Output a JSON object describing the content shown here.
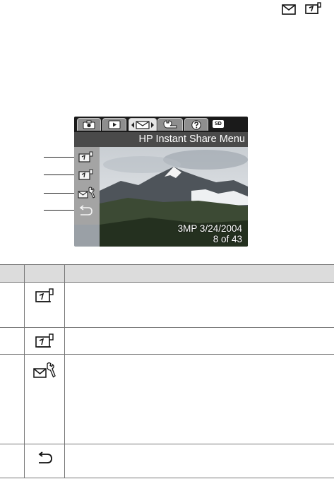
{
  "header": {
    "icons": [
      "email-envelope-icon",
      "print-icon"
    ]
  },
  "camera_screen": {
    "tabs": [
      {
        "icon": "camera-icon",
        "selected": false
      },
      {
        "icon": "playback-icon",
        "selected": false
      },
      {
        "icon": "share-email-icon",
        "selected": true
      },
      {
        "icon": "wrench-icon",
        "selected": false
      },
      {
        "icon": "help-icon",
        "selected": false
      }
    ],
    "sd_badge": "SD",
    "menu_title": "HP Instant Share Menu",
    "menu_items": [
      {
        "icon": "print-icon"
      },
      {
        "icon": "print-icon"
      },
      {
        "icon": "email-setup-wrench-icon"
      },
      {
        "icon": "return-arrow-icon"
      }
    ],
    "photo_info": {
      "resolution_date": "3MP  3/24/2004",
      "position": "8 of 43"
    }
  },
  "table": {
    "header_row": [
      "",
      "",
      ""
    ],
    "rows": [
      {
        "icon": "print-icon"
      },
      {
        "icon": "print-icon"
      },
      {
        "icon": "email-setup-wrench-icon"
      },
      {
        "icon": "return-arrow-icon"
      }
    ]
  },
  "colors": {
    "tab_bar": "#1a1a1a",
    "title_bar": "#4a4a4a",
    "menu_strip": "#a4a4a4",
    "table_header": "#dcdcdc"
  }
}
